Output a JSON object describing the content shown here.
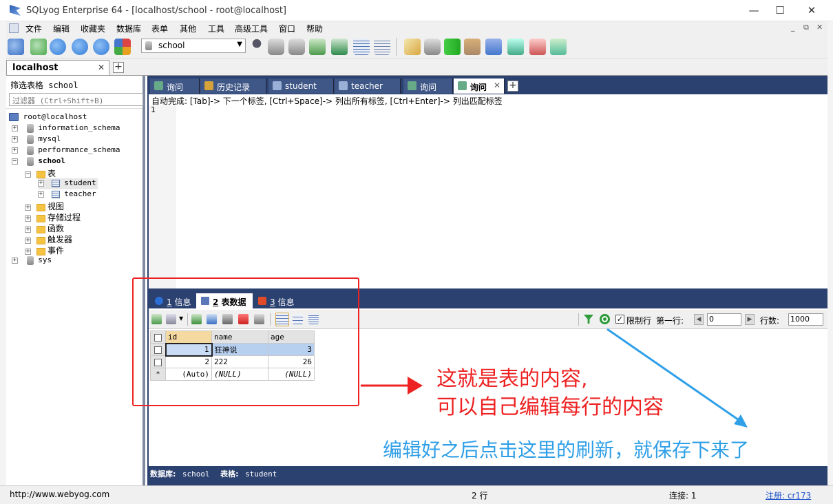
{
  "window": {
    "title": "SQLyog Enterprise 64 - [localhost/school - root@localhost]",
    "controls": {
      "minimize": "—",
      "maximize": "☐",
      "close": "✕"
    },
    "inner_controls": {
      "minimize": "_",
      "restore": "⧉",
      "close": "✕"
    }
  },
  "menu": [
    "文件",
    "编辑",
    "收藏夹",
    "数据库",
    "表单",
    "其他",
    "工具",
    "高级工具",
    "窗口",
    "帮助"
  ],
  "toolbar": {
    "database_select": "school",
    "colors": [
      "#3a6fc4",
      "#4aa84a",
      "#2f78d6",
      "#2f78d6",
      "#d44",
      "#e8a020",
      "#556",
      "#5a8",
      "#4a9",
      "#3b8f3b",
      "#2d8a4a",
      "#4b6fb0",
      "#6a7fa8",
      "#d9a640",
      "#9ab",
      "#7b9",
      "#4c4",
      "#a86",
      "#47c",
      "#4a8",
      "#c55",
      "#5b9"
    ]
  },
  "connection_tab": {
    "label": "localhost",
    "close": "✕",
    "add": "+"
  },
  "object_browser": {
    "filter_label": "筛选表格 school",
    "filter_placeholder": "过滤器 (Ctrl+Shift+B)",
    "root": "root@localhost",
    "databases": [
      {
        "name": "information_schema",
        "expander": "+"
      },
      {
        "name": "mysql",
        "expander": "+"
      },
      {
        "name": "performance_schema",
        "expander": "+"
      },
      {
        "name": "school",
        "expander": "−"
      }
    ],
    "school_folder": {
      "label": "表",
      "expander": "−"
    },
    "tables": [
      {
        "name": "student",
        "expander": "+"
      },
      {
        "name": "teacher",
        "expander": "+"
      }
    ],
    "folders": [
      {
        "label": "视图",
        "expander": "+"
      },
      {
        "label": "存储过程",
        "expander": "+"
      },
      {
        "label": "函数",
        "expander": "+"
      },
      {
        "label": "触发器",
        "expander": "+"
      },
      {
        "label": "事件",
        "expander": "+"
      }
    ],
    "last_db": {
      "name": "sys",
      "expander": "+"
    }
  },
  "query_tabs": [
    {
      "label": "询问",
      "icon_color": "#6a8"
    },
    {
      "label": "历史记录",
      "icon_color": "#d6a23a"
    },
    {
      "label": "student",
      "icon_color": "#9bb0d6"
    },
    {
      "label": "teacher",
      "icon_color": "#9bb0d6"
    },
    {
      "label": "询问",
      "icon_color": "#6a8"
    },
    {
      "label": "询问",
      "icon_color": "#6a8",
      "active": true,
      "close": "✕"
    }
  ],
  "query_tab_add": "+",
  "hint": "自动完成: [Tab]-> 下一个标签, [Ctrl+Space]-> 列出所有标签, [Ctrl+Enter]-> 列出匹配标签",
  "editor": {
    "line": "1"
  },
  "result_tabs": [
    {
      "num": "1",
      "label": "信息",
      "icon_color": "#2b6fd6"
    },
    {
      "num": "2",
      "label": "表数据",
      "icon_color": "#5a78b8",
      "active": true
    },
    {
      "num": "3",
      "label": "信息",
      "icon_color": "#e04a2a"
    }
  ],
  "result_toolbar": {
    "limit_rows_label": "限制行",
    "first_row_label": "第一行:",
    "first_row_value": "0",
    "rows_label": "行数:",
    "rows_value": "1000",
    "prev": "◀",
    "next": "▶"
  },
  "grid": {
    "columns": [
      "id",
      "name",
      "age"
    ],
    "rows": [
      {
        "id": "1",
        "name": "狂神说",
        "age": "3"
      },
      {
        "id": "2",
        "name": "222",
        "age": "26"
      }
    ],
    "new_row": {
      "marker": "*",
      "id": "(Auto)",
      "name": "(NULL)",
      "age": "(NULL)"
    }
  },
  "db_info": {
    "db_label": "数据库:",
    "db_value": "school",
    "table_label": "表格:",
    "table_value": "student"
  },
  "statusbar": {
    "url": "http://www.webyog.com",
    "rows": "2 行",
    "connection": "连接: 1",
    "register": "注册: cr173"
  },
  "annotations": {
    "red_line1": "这就是表的内容,",
    "red_line2": "可以自己编辑每行的内容",
    "blue": "编辑好之后点击这里的刷新，就保存下来了",
    "red_color": "#ee2222",
    "blue_color": "#2f9fe8"
  }
}
